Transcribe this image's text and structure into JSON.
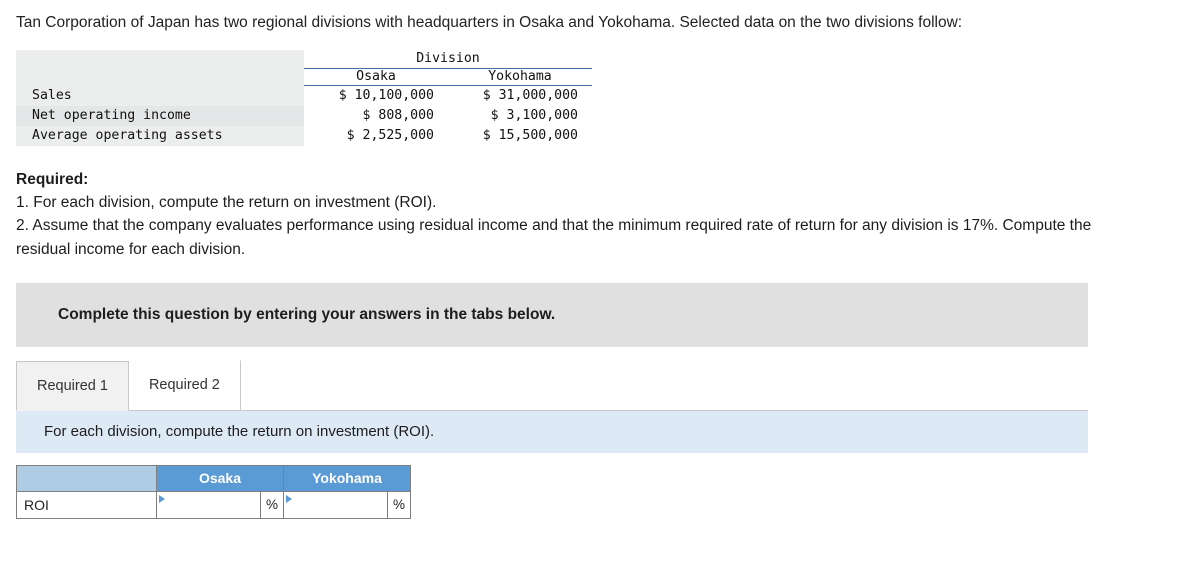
{
  "intro": "Tan Corporation of Japan has two regional divisions with headquarters in Osaka and Yokohama. Selected data on the two divisions follow:",
  "data_table": {
    "group_header": "Division",
    "columns": [
      "Osaka",
      "Yokohama"
    ],
    "rows": [
      {
        "label": "Sales",
        "osaka": "$ 10,100,000",
        "yokohama": "$ 31,000,000"
      },
      {
        "label": "Net operating income",
        "osaka": "$ 808,000",
        "yokohama": "$ 3,100,000"
      },
      {
        "label": "Average operating assets",
        "osaka": "$ 2,525,000",
        "yokohama": "$ 15,500,000"
      }
    ]
  },
  "required": {
    "heading": "Required:",
    "item1": "1. For each division, compute the return on investment (ROI).",
    "item2": "2. Assume that the company evaluates performance using residual income and that the minimum required rate of return for any division is 17%. Compute the residual income for each division."
  },
  "complete_band": "Complete this question by entering your answers in the tabs below.",
  "tabs": [
    {
      "label": "Required 1",
      "active": true
    },
    {
      "label": "Required 2",
      "active": false
    }
  ],
  "prompt": "For each division, compute the return on investment (ROI).",
  "answer_table": {
    "headers": [
      "",
      "Osaka",
      "Yokohama"
    ],
    "row_label": "ROI",
    "osaka_value": "",
    "yokohama_value": "",
    "percent_symbol": "%",
    "placeholder": ""
  },
  "colors": {
    "header_blue": "#5b9bd5",
    "prompt_blue": "#ddeaf6",
    "band_gray": "#e0e0e0",
    "rule_blue": "#4472a8"
  }
}
